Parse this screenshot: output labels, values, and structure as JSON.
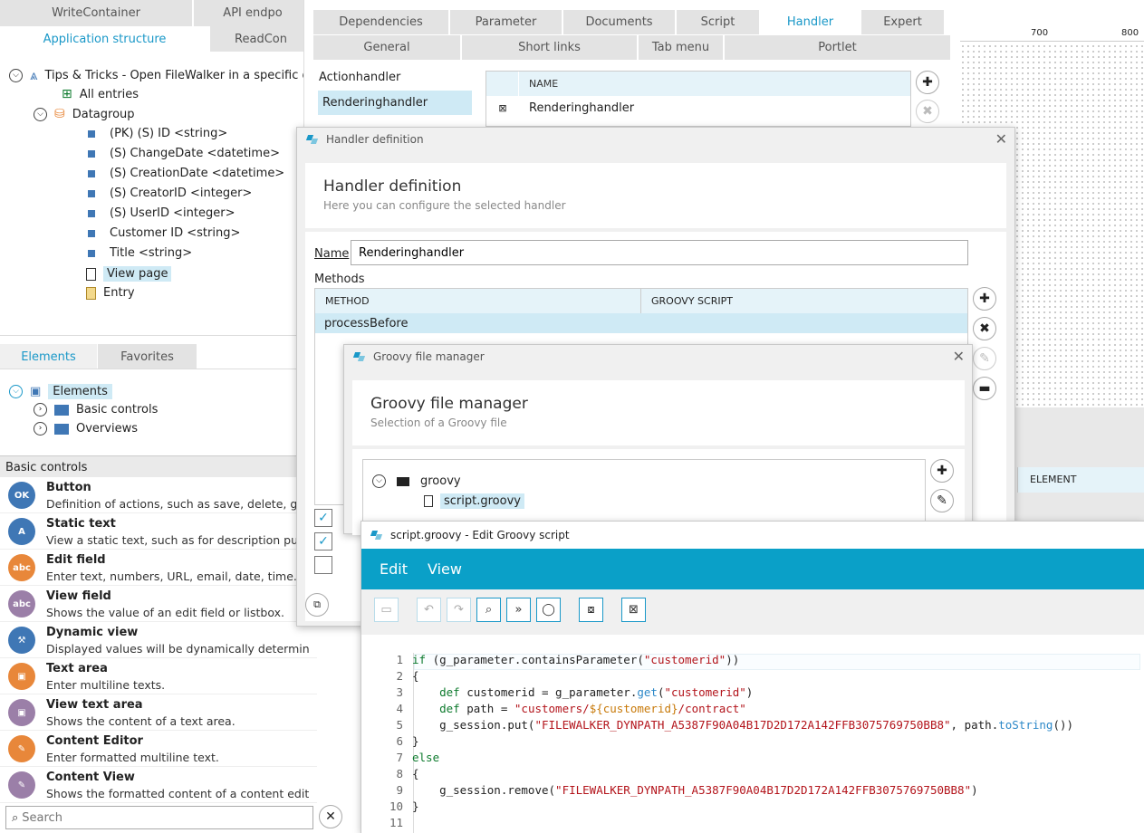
{
  "left": {
    "top_tabs": [
      "WriteContainer",
      "API endpo",
      "Application structure",
      "ReadCon"
    ],
    "tree": {
      "root": "Tips & Tricks - Open FileWalker in a specific dir",
      "all_entries": "All entries",
      "datagroup": "Datagroup",
      "fields": [
        "(PK) (S) ID <string>",
        "(S) ChangeDate <datetime>",
        "(S) CreationDate <datetime>",
        "(S) CreatorID <integer>",
        "(S) UserID <integer>",
        "Customer ID <string>",
        "Title <string>"
      ],
      "view_page": "View page",
      "entry": "Entry"
    },
    "elements_tabs": [
      "Elements",
      "Favorites"
    ],
    "elements_tree": {
      "root": "Elements",
      "children": [
        "Basic controls",
        "Overviews"
      ]
    },
    "section_label": "Basic controls",
    "controls": [
      {
        "name": "Button",
        "desc": "Definition of actions, such as save, delete, go to",
        "icon": "OK",
        "color": "#3f77b5"
      },
      {
        "name": "Static text",
        "desc": "View a static text, such as for description purpos",
        "icon": "A",
        "color": "#3f77b5"
      },
      {
        "name": "Edit field",
        "desc": "Enter text, numbers, URL, email, date, time.",
        "icon": "abc",
        "color": "#e8873a"
      },
      {
        "name": "View field",
        "desc": "Shows the value of an edit field or listbox.",
        "icon": "abc",
        "color": "#9b7fa8"
      },
      {
        "name": "Dynamic view",
        "desc": "Displayed values will be dynamically determined.",
        "icon": "⚒",
        "color": "#3f77b5"
      },
      {
        "name": "Text area",
        "desc": "Enter multiline texts.",
        "icon": "▣",
        "color": "#e8873a"
      },
      {
        "name": "View text area",
        "desc": "Shows the content of a text area.",
        "icon": "▣",
        "color": "#9b7fa8"
      },
      {
        "name": "Content Editor",
        "desc": "Enter formatted multiline text.",
        "icon": "✎",
        "color": "#e8873a"
      },
      {
        "name": "Content View",
        "desc": "Shows the formatted content of a content editor.",
        "icon": "✎",
        "color": "#9b7fa8"
      }
    ],
    "search_placeholder": "Search"
  },
  "props": {
    "tabs_row1": [
      "Dependencies",
      "Parameter",
      "Documents",
      "Script",
      "Handler",
      "Expert"
    ],
    "tabs_row2": [
      "General",
      "Short links",
      "Tab menu",
      "Portlet"
    ],
    "handler_types": [
      "Actionhandler",
      "Renderinghandler"
    ],
    "table_header": "NAME",
    "table_row": "Renderinghandler"
  },
  "ruler": {
    "marks": [
      "700",
      "800"
    ],
    "column_header": "ELEMENT"
  },
  "handler_dialog": {
    "title_bar": "Handler definition",
    "title": "Handler definition",
    "subtitle": "Here you can configure the selected handler",
    "name_label": "Name",
    "name_value": "Renderinghandler",
    "methods_label": "Methods",
    "col_method": "METHOD",
    "col_script": "GROOVY SCRIPT",
    "row_method": "processBefore"
  },
  "groovy_dialog": {
    "title_bar": "Groovy file manager",
    "title": "Groovy file manager",
    "subtitle": "Selection of a Groovy file",
    "folder": "groovy",
    "file": "script.groovy"
  },
  "editor": {
    "title_bar": "script.groovy - Edit Groovy script",
    "menu": [
      "Edit",
      "View"
    ],
    "lines": [
      "if (g_parameter.containsParameter(\"customerid\"))",
      "{",
      "    def customerid = g_parameter.get(\"customerid\")",
      "    def path = \"customers/${customerid}/contract\"",
      "    g_session.put(\"FILEWALKER_DYNPATH_A5387F90A04B17D2D172A142FFB3075769750BB8\", path.toString())",
      "}",
      "else",
      "{",
      "    g_session.remove(\"FILEWALKER_DYNPATH_A5387F90A04B17D2D172A142FFB3075769750BB8\")",
      "}",
      ""
    ]
  },
  "colors": {
    "accent": "#1a98c8",
    "selection": "#cfeaf5"
  }
}
